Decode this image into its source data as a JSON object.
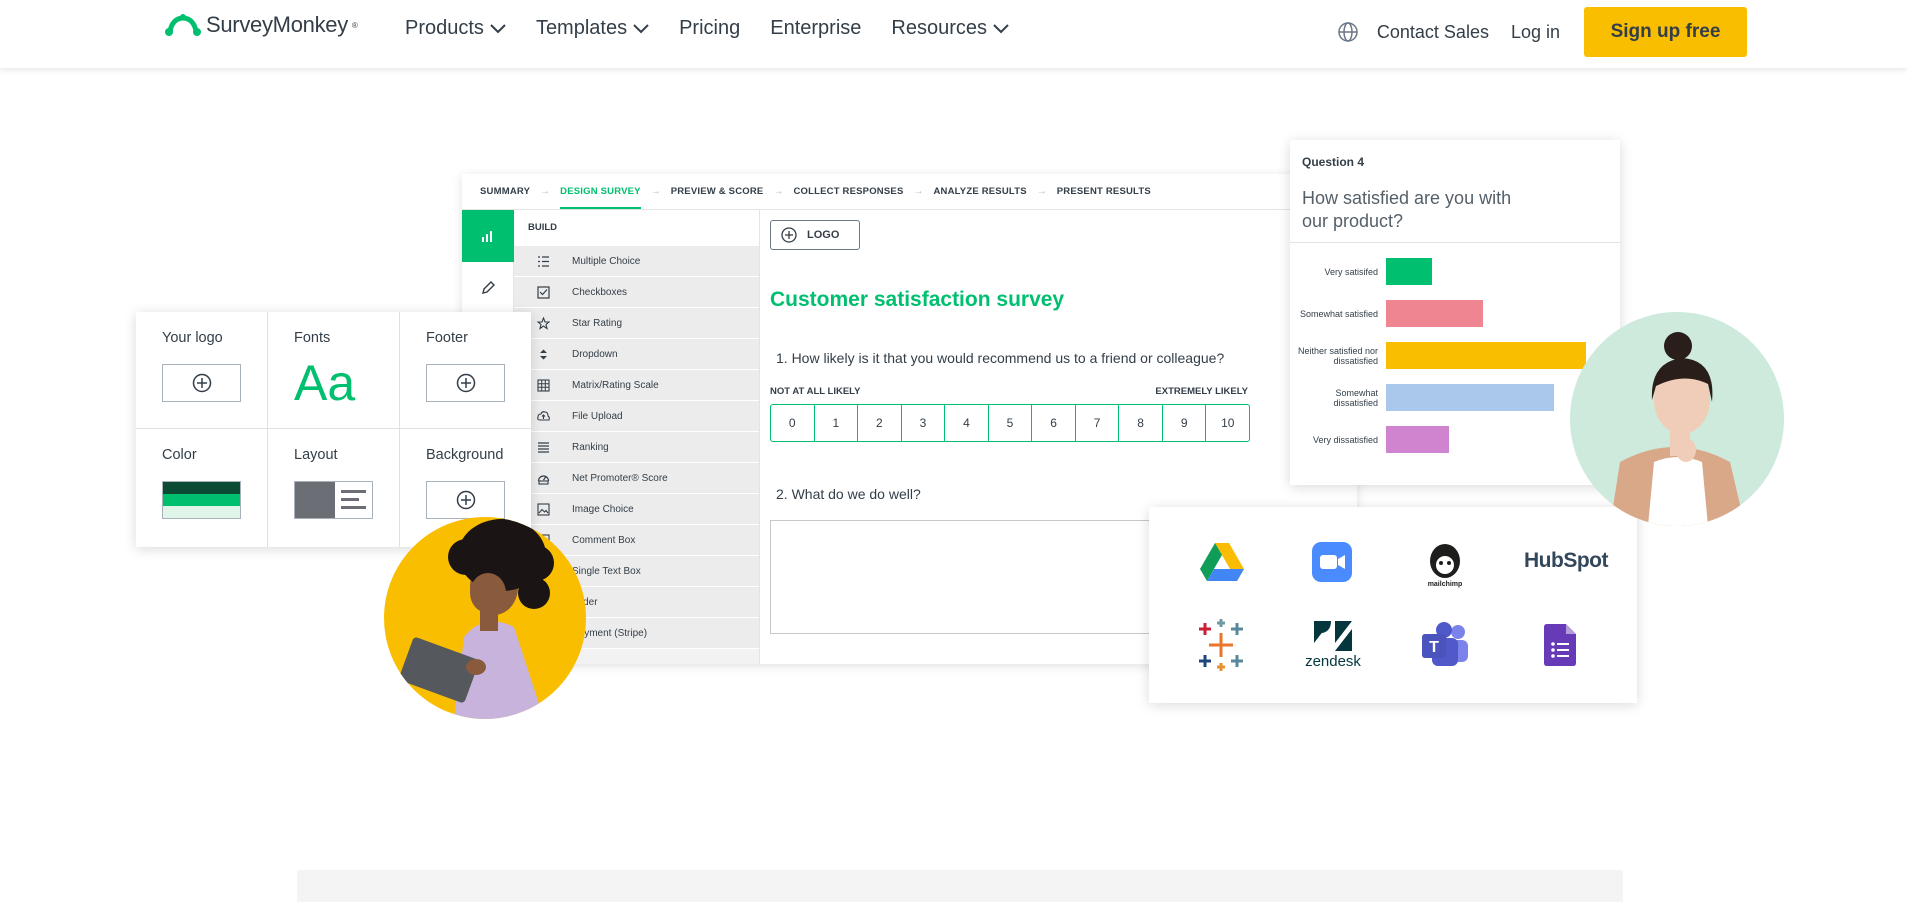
{
  "nav": {
    "brand": "SurveyMonkey",
    "menu": [
      {
        "label": "Products",
        "dropdown": true
      },
      {
        "label": "Templates",
        "dropdown": true
      },
      {
        "label": "Pricing",
        "dropdown": false
      },
      {
        "label": "Enterprise",
        "dropdown": false
      },
      {
        "label": "Resources",
        "dropdown": true
      }
    ],
    "contact_sales": "Contact Sales",
    "login": "Log in",
    "signup": "Sign up free",
    "accent": "#f9be00"
  },
  "steps": [
    "SUMMARY",
    "DESIGN SURVEY",
    "PREVIEW & SCORE",
    "COLLECT RESPONSES",
    "ANALYZE RESULTS",
    "PRESENT RESULTS"
  ],
  "active_step": "DESIGN SURVEY",
  "build": {
    "heading": "BUILD",
    "items": [
      {
        "label": "Multiple Choice",
        "icon": "list-icon"
      },
      {
        "label": "Checkboxes",
        "icon": "checkbox-icon"
      },
      {
        "label": "Star Rating",
        "icon": "star-icon"
      },
      {
        "label": "Dropdown",
        "icon": "dropdown-icon"
      },
      {
        "label": "Matrix/Rating Scale",
        "icon": "grid-icon"
      },
      {
        "label": "File Upload",
        "icon": "upload-icon"
      },
      {
        "label": "Ranking",
        "icon": "ranking-icon"
      },
      {
        "label": "Net Promoter® Score",
        "icon": "gauge-icon"
      },
      {
        "label": "Image Choice",
        "icon": "image-icon"
      },
      {
        "label": "Comment Box",
        "icon": "comment-icon"
      },
      {
        "label": "Single Text Box",
        "icon": "textbox-icon"
      },
      {
        "label": "Slider",
        "icon": "slider-icon"
      },
      {
        "label": "Payment (Stripe)",
        "icon": "payment-icon"
      }
    ]
  },
  "survey": {
    "logo_button": "LOGO",
    "title": "Customer satisfaction survey",
    "q1": "1.  How likely is it that you would recommend us to a friend or colleague?",
    "nps_low": "NOT AT ALL LIKELY",
    "nps_high": "EXTREMELY LIKELY",
    "nps_scale": [
      "0",
      "1",
      "2",
      "3",
      "4",
      "5",
      "6",
      "7",
      "8",
      "9",
      "10"
    ],
    "q2": "2.  What do we do well?",
    "brand_green": "#00bf6f"
  },
  "settings": {
    "your_logo": "Your logo",
    "fonts": "Fonts",
    "fonts_sample": "Aa",
    "footer": "Footer",
    "color": "Color",
    "layout": "Layout",
    "background": "Background"
  },
  "question4": {
    "label": "Question 4",
    "question": "How satisfied are you with our product?",
    "bars": [
      {
        "label": "Very satisifed",
        "value": 0.22,
        "color": "#00bf6f"
      },
      {
        "label": "Somewhat satisfied",
        "value": 0.46,
        "color": "#ee8591"
      },
      {
        "label": "Neither satisfied nor dissatisfied",
        "value": 0.95,
        "color": "#f9be00"
      },
      {
        "label": "Somewhat dissatisfied",
        "value": 0.8,
        "color": "#a9c8ec"
      },
      {
        "label": "Very dissatisfied",
        "value": 0.3,
        "color": "#d083cf"
      }
    ]
  },
  "integrations": {
    "mailchimp": "mailchimp",
    "hubspot": "HubSpot",
    "zendesk": "zendesk",
    "icons": [
      "google-drive-icon",
      "zoom-icon",
      "mailchimp-icon",
      "hubspot-icon",
      "tableau-icon",
      "zendesk-icon",
      "teams-icon",
      "google-forms-icon"
    ]
  }
}
